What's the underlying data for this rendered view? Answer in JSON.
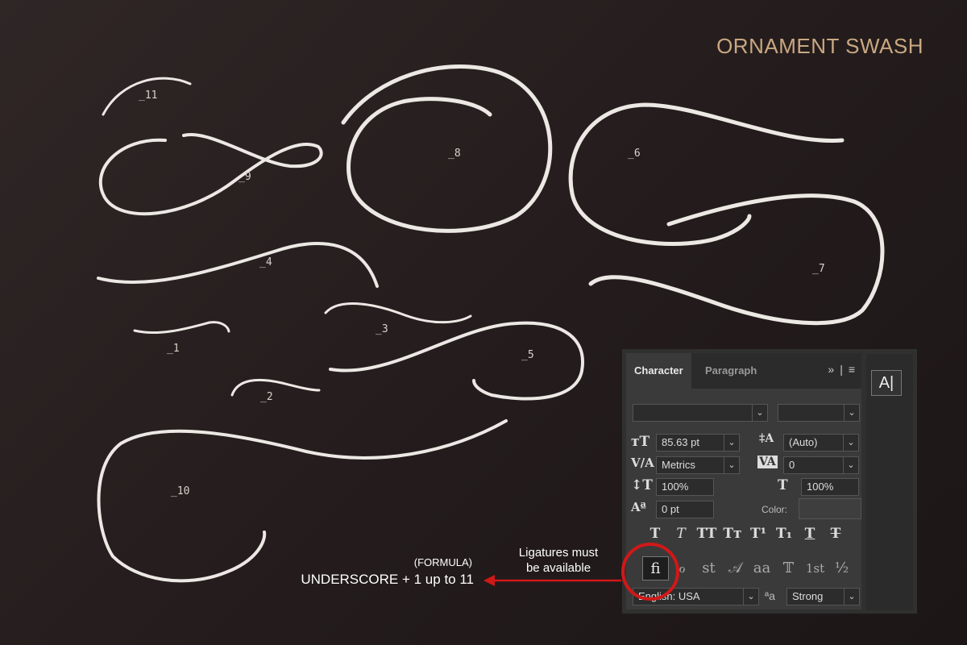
{
  "title": "ORNAMENT SWASH",
  "swash_labels": [
    "_11",
    "_9",
    "_8",
    "_6",
    "_4",
    "_7",
    "_1",
    "_3",
    "_5",
    "_2",
    "_10"
  ],
  "formula": {
    "line1": "(FORMULA)",
    "line2": "UNDERSCORE + 1 up to 11"
  },
  "note": {
    "line1": "Ligatures must",
    "line2": "be available"
  },
  "colors": {
    "accent_title": "#c9a882",
    "swash": "#ece8e4",
    "arrow": "#d01818"
  },
  "panel": {
    "tabs": [
      "Character",
      "Paragraph"
    ],
    "active_tab": "Character",
    "font_size": "85.63 pt",
    "leading": "(Auto)",
    "kerning": "Metrics",
    "tracking": "0",
    "vertical_scale": "100%",
    "horizontal_scale": "100%",
    "baseline_shift": "0 pt",
    "color_label": "Color:",
    "language": "English: USA",
    "antialias": "Strong",
    "antialias_icon": "ªa",
    "style_buttons": [
      "T",
      "T",
      "TT",
      "Tт",
      "T¹",
      "T₁",
      "T",
      "T"
    ],
    "opentype_buttons": [
      "ﬁ",
      "ℴ",
      "st",
      "𝒜",
      "aa",
      "𝕋",
      "1st",
      "½"
    ],
    "side_icon": "A|"
  }
}
